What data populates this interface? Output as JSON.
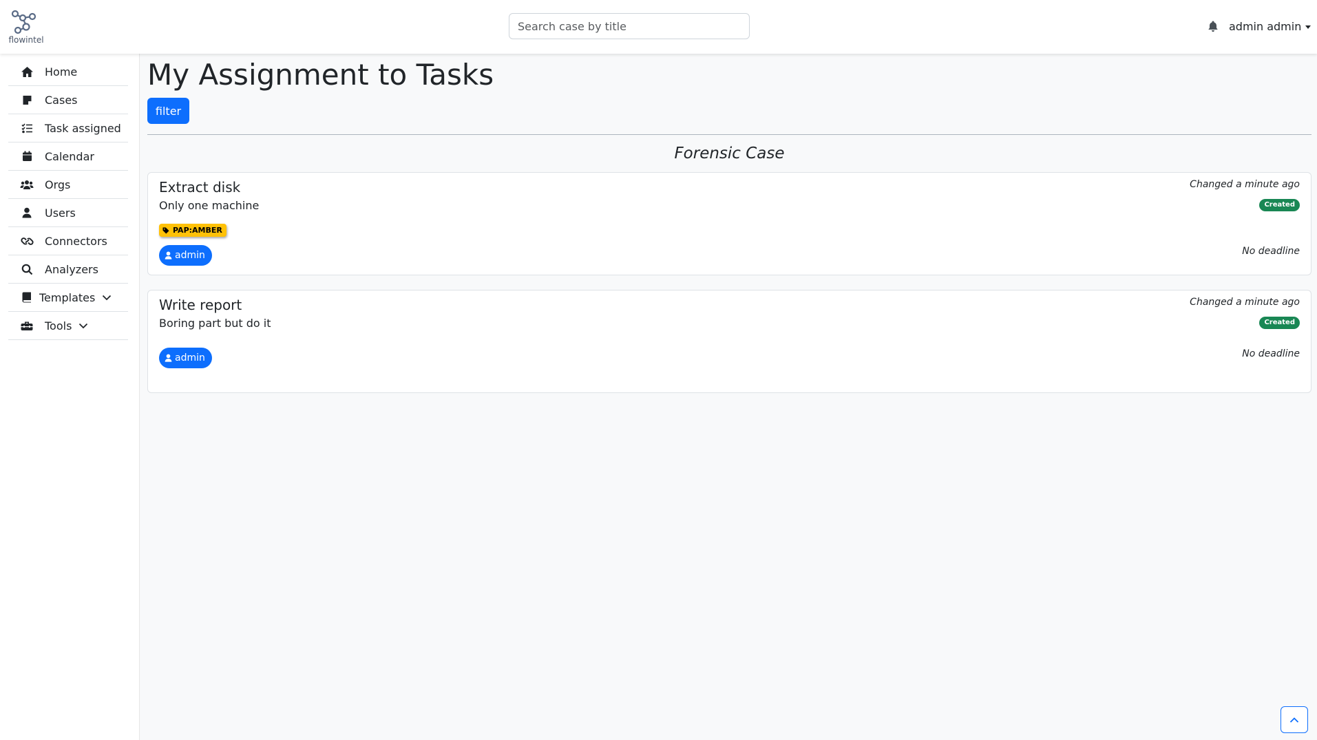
{
  "header": {
    "logo_text": "flowintel",
    "search_placeholder": "Search case by title",
    "user_name": "admin admin"
  },
  "sidebar": {
    "items": [
      {
        "label": "Home",
        "icon": "home-icon"
      },
      {
        "label": "Cases",
        "icon": "note-icon"
      },
      {
        "label": "Task assigned",
        "icon": "list-check-icon"
      },
      {
        "label": "Calendar",
        "icon": "calendar-icon"
      },
      {
        "label": "Orgs",
        "icon": "users-group-icon"
      },
      {
        "label": "Users",
        "icon": "user-icon"
      },
      {
        "label": "Connectors",
        "icon": "link-icon"
      },
      {
        "label": "Analyzers",
        "icon": "search-icon"
      },
      {
        "label": "Templates",
        "icon": "book-icon"
      },
      {
        "label": "Tools",
        "icon": "toolbox-icon"
      }
    ]
  },
  "main": {
    "title": "My Assignment to Tasks",
    "filter_label": "filter",
    "case_title": "Forensic Case",
    "tasks": [
      {
        "name": "Extract disk",
        "description": "Only one machine",
        "changed": "Changed a minute ago",
        "status": "Created",
        "tag": "PAP:AMBER",
        "assignee": "admin",
        "deadline": "No deadline"
      },
      {
        "name": "Write report",
        "description": "Boring part but do it",
        "changed": "Changed a minute ago",
        "status": "Created",
        "assignee": "admin",
        "deadline": "No deadline"
      }
    ]
  },
  "colors": {
    "primary": "#0d6efd",
    "success": "#198754",
    "warning": "#ffc107"
  }
}
